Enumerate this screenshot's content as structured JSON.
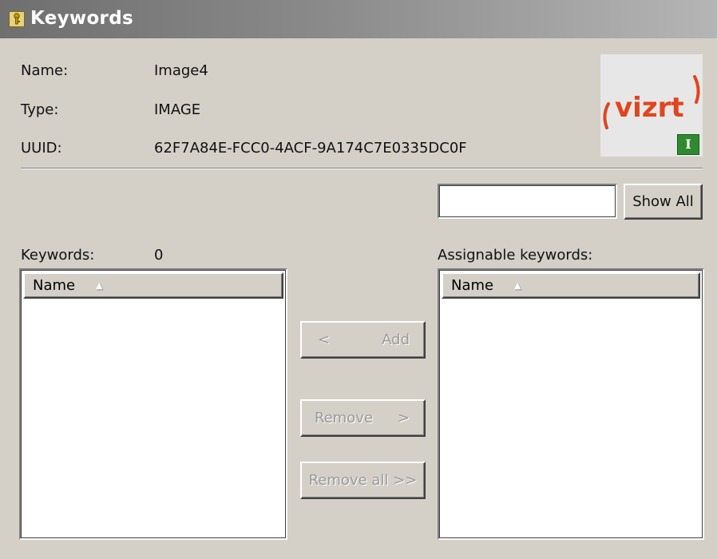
{
  "window": {
    "title": "Keywords",
    "title_icon": "keyword-tag-icon"
  },
  "info": {
    "name_label": "Name:",
    "name_value": "Image4",
    "type_label": "Type:",
    "type_value": "IMAGE",
    "uuid_label": "UUID:",
    "uuid_value": "62F7A84E-FCC0-4ACF-9A174C7E0335DC0F"
  },
  "thumbnail": {
    "logo_text": "vizrt",
    "logo_color": "#e0451f",
    "badge_text": "I",
    "badge_color": "#2f8a2f"
  },
  "search": {
    "value": "",
    "show_all_label": "Show All"
  },
  "keywords": {
    "label": "Keywords:",
    "count": "0",
    "column_name": "Name",
    "rows": []
  },
  "assignable": {
    "label": "Assignable keywords:",
    "column_name": "Name",
    "rows": []
  },
  "actions": {
    "add_arrow": "<",
    "add_label": "Add",
    "remove_label": "Remove",
    "remove_arrow": ">",
    "remove_all_label": "Remove all >>"
  },
  "colors": {
    "window_bg": "#d4d0c8",
    "disabled_text": "#9a9a9a"
  }
}
